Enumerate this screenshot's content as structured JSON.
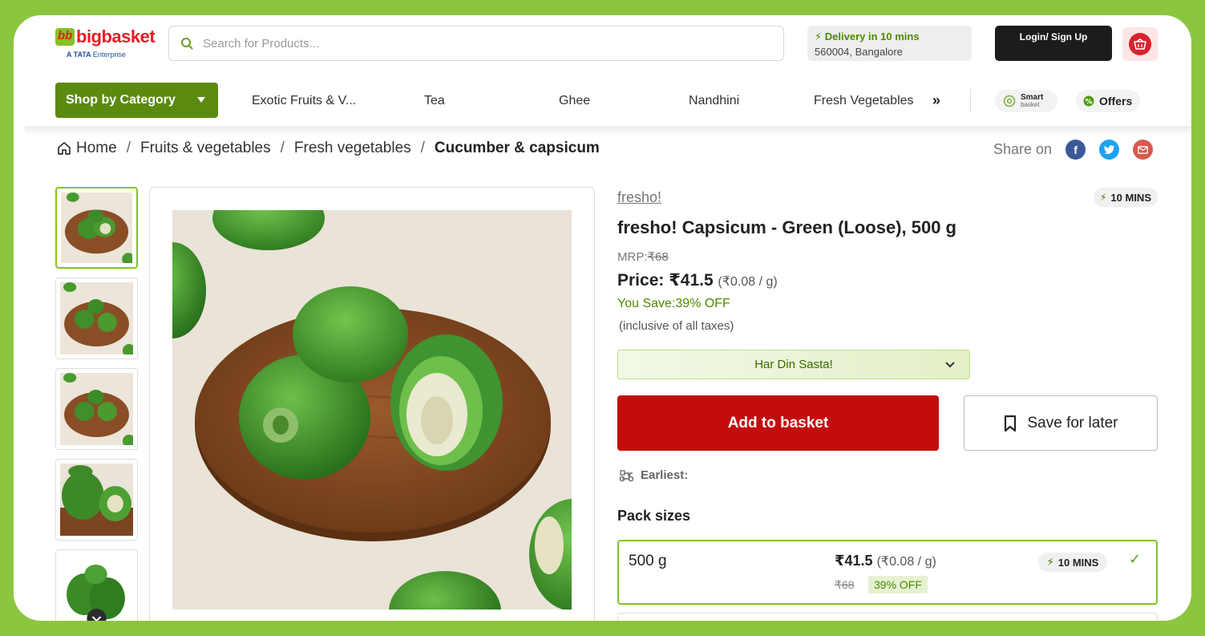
{
  "header": {
    "logo_text_a": "bb",
    "logo_text_b": "bigbasket",
    "logo_sub_brand": "A TATA",
    "logo_sub_rest": "Enterprise",
    "search_placeholder": "Search for Products...",
    "delivery_title": "Delivery in 10 mins",
    "delivery_location": "560004, Bangalore",
    "login_label": "Login/ Sign Up"
  },
  "nav": {
    "shop_by_category": "Shop by Category",
    "items": [
      "Exotic Fruits & V...",
      "Tea",
      "Ghee",
      "Nandhini",
      "Fresh Vegetables"
    ],
    "more": "»",
    "smart_label": "Smart",
    "smart_sub": "basket",
    "offers_label": "Offers"
  },
  "breadcrumb": {
    "items": [
      "Home",
      "Fruits & vegetables",
      "Fresh vegetables",
      "Cucumber & capsicum"
    ],
    "separator": "/"
  },
  "share": {
    "label": "Share on",
    "facebook": "f",
    "twitter": "t"
  },
  "product": {
    "brand": "fresho!",
    "delivery_badge": "10 MINS",
    "title": "fresho! Capsicum - Green (Loose), 500 g",
    "mrp_label": "MRP:",
    "mrp_value": "₹68",
    "price_label": "Price: ₹41.5",
    "price_unit": "(₹0.08 / g)",
    "you_save": "You Save:39% OFF",
    "tax_note": "(inclusive of all taxes)",
    "promo_label": "Har Din Sasta!",
    "add_to_basket": "Add to basket",
    "save_for_later": "Save for later",
    "earliest_label": "Earliest:"
  },
  "packs": {
    "heading": "Pack sizes",
    "items": [
      {
        "size": "500 g",
        "price": "₹41.5",
        "unit": "(₹0.08 / g)",
        "mrp": "₹68",
        "off": "39% OFF",
        "badge": "10 MINS",
        "selected_mark": "✓"
      }
    ]
  },
  "colors": {
    "brand_green": "#84c225",
    "category_button": "#5b8a11",
    "add_button": "#c40c0c",
    "page_border": "#8cc63f"
  },
  "gallery": {
    "thumb_count": 5,
    "active_index": 0
  }
}
